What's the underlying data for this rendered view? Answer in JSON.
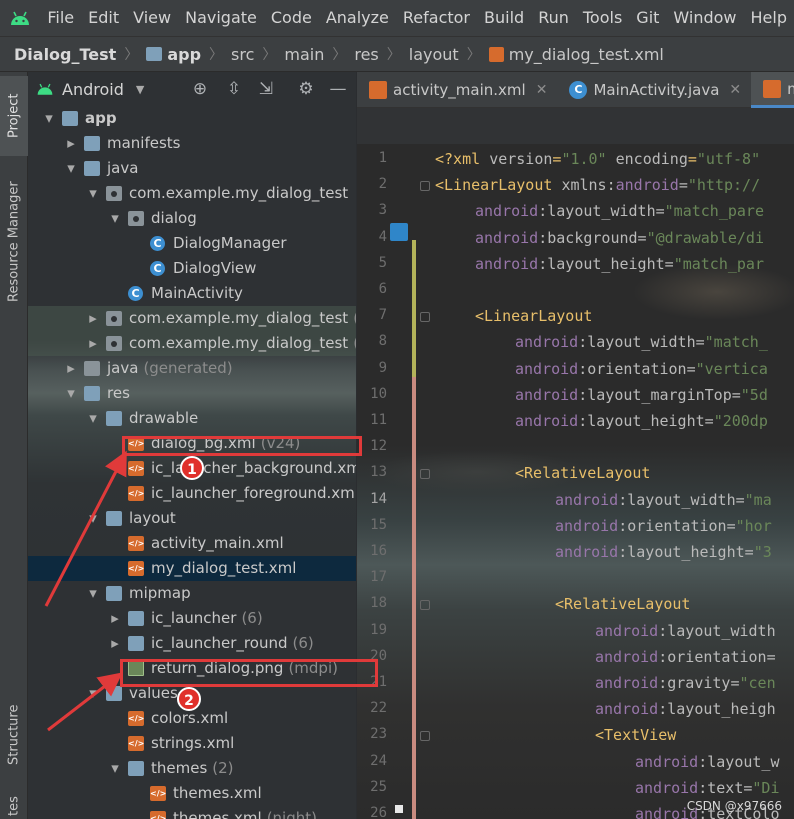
{
  "menubar": {
    "items": [
      "File",
      "Edit",
      "View",
      "Navigate",
      "Code",
      "Analyze",
      "Refactor",
      "Build",
      "Run",
      "Tools",
      "Git",
      "Window",
      "Help"
    ]
  },
  "breadcrumb": [
    "Dialog_Test",
    "app",
    "src",
    "main",
    "res",
    "layout",
    "my_dialog_test.xml"
  ],
  "toolstrip": {
    "project": "Project",
    "resource_manager": "Resource Manager",
    "structure": "Structure",
    "bottom": "tes"
  },
  "project_panel": {
    "view_mode": "Android",
    "tree": [
      {
        "label": "app",
        "depth": 0,
        "expanded": true,
        "icon": "module-icon",
        "bold": true
      },
      {
        "label": "manifests",
        "depth": 1,
        "expanded": false,
        "icon": "folder-icon"
      },
      {
        "label": "java",
        "depth": 1,
        "expanded": true,
        "icon": "folder-icon"
      },
      {
        "label": "com.example.my_dialog_test",
        "depth": 2,
        "expanded": true,
        "icon": "package-icon"
      },
      {
        "label": "dialog",
        "depth": 3,
        "expanded": true,
        "icon": "package-icon"
      },
      {
        "label": "DialogManager",
        "depth": 4,
        "icon": "class-icon"
      },
      {
        "label": "DialogView",
        "depth": 4,
        "icon": "class-icon"
      },
      {
        "label": "MainActivity",
        "depth": 3,
        "icon": "class-icon"
      },
      {
        "label": "com.example.my_dialog_test",
        "sub": "(a",
        "depth": 2,
        "expanded": false,
        "icon": "package-icon",
        "highlight": true
      },
      {
        "label": "com.example.my_dialog_test",
        "sub": "(t",
        "depth": 2,
        "expanded": false,
        "icon": "package-icon",
        "highlight": true
      },
      {
        "label": "java",
        "sub": "(generated)",
        "depth": 1,
        "expanded": false,
        "icon": "generated-folder-icon"
      },
      {
        "label": "res",
        "depth": 1,
        "expanded": true,
        "icon": "folder-icon"
      },
      {
        "label": "drawable",
        "depth": 2,
        "expanded": true,
        "icon": "folder-icon"
      },
      {
        "label": "dialog_bg.xml",
        "sub": "(v24)",
        "depth": 3,
        "icon": "xml-icon"
      },
      {
        "label": "ic_launcher_background.xml",
        "depth": 3,
        "icon": "xml-icon"
      },
      {
        "label": "ic_launcher_foreground.xml",
        "depth": 3,
        "icon": "xml-icon"
      },
      {
        "label": "layout",
        "depth": 2,
        "expanded": true,
        "icon": "folder-icon"
      },
      {
        "label": "activity_main.xml",
        "depth": 3,
        "icon": "xml-icon"
      },
      {
        "label": "my_dialog_test.xml",
        "depth": 3,
        "icon": "xml-icon",
        "selected": true
      },
      {
        "label": "mipmap",
        "depth": 2,
        "expanded": true,
        "icon": "folder-icon"
      },
      {
        "label": "ic_launcher",
        "sub": "(6)",
        "depth": 3,
        "expanded": false,
        "icon": "folder-icon"
      },
      {
        "label": "ic_launcher_round",
        "sub": "(6)",
        "depth": 3,
        "expanded": false,
        "icon": "folder-icon"
      },
      {
        "label": "return_dialog.png",
        "sub": "(mdpi)",
        "depth": 3,
        "icon": "png-icon"
      },
      {
        "label": "values",
        "depth": 2,
        "expanded": true,
        "icon": "folder-icon"
      },
      {
        "label": "colors.xml",
        "depth": 3,
        "icon": "xml-icon"
      },
      {
        "label": "strings.xml",
        "depth": 3,
        "icon": "xml-icon"
      },
      {
        "label": "themes",
        "sub": "(2)",
        "depth": 3,
        "expanded": true,
        "icon": "folder-icon"
      },
      {
        "label": "themes.xml",
        "depth": 4,
        "icon": "xml-icon"
      },
      {
        "label": "themes.xml",
        "sub": "(night)",
        "depth": 4,
        "icon": "xml-icon"
      }
    ]
  },
  "editor": {
    "tabs": [
      {
        "label": "activity_main.xml",
        "icon": "xml-icon",
        "active": false
      },
      {
        "label": "MainActivity.java",
        "icon": "class-icon",
        "active": false
      },
      {
        "label": "my_",
        "icon": "xml-icon",
        "active": true
      }
    ],
    "current_line": 14,
    "lines": [
      {
        "n": 1,
        "indent": 0,
        "parts": [
          [
            "pi",
            "<?xml "
          ],
          [
            "attr",
            "version"
          ],
          [
            "pi",
            "="
          ],
          [
            "val",
            "\"1.0\""
          ],
          [
            "attr",
            " encoding"
          ],
          [
            "pi",
            "="
          ],
          [
            "val",
            "\"utf-8\""
          ]
        ]
      },
      {
        "n": 2,
        "indent": 0,
        "parts": [
          [
            "tag",
            "<LinearLayout "
          ],
          [
            "attr",
            "xmlns:"
          ],
          [
            "ns",
            "android"
          ],
          [
            "attr",
            "="
          ],
          [
            "val",
            "\"http://"
          ]
        ]
      },
      {
        "n": 3,
        "indent": 4,
        "parts": [
          [
            "ns",
            "android"
          ],
          [
            "attr",
            ":layout_width="
          ],
          [
            "val",
            "\"match_pare"
          ]
        ]
      },
      {
        "n": 4,
        "indent": 4,
        "parts": [
          [
            "ns",
            "android"
          ],
          [
            "attr",
            ":background="
          ],
          [
            "val",
            "\"@drawable/di"
          ]
        ]
      },
      {
        "n": 5,
        "indent": 4,
        "parts": [
          [
            "ns",
            "android"
          ],
          [
            "attr",
            ":layout_height="
          ],
          [
            "val",
            "\"match_par"
          ]
        ]
      },
      {
        "n": 6,
        "indent": 0,
        "parts": []
      },
      {
        "n": 7,
        "indent": 4,
        "parts": [
          [
            "tag",
            "<LinearLayout"
          ]
        ]
      },
      {
        "n": 8,
        "indent": 8,
        "parts": [
          [
            "ns",
            "android"
          ],
          [
            "attr",
            ":layout_width="
          ],
          [
            "val",
            "\"match_"
          ]
        ]
      },
      {
        "n": 9,
        "indent": 8,
        "parts": [
          [
            "ns",
            "android"
          ],
          [
            "attr",
            ":orientation="
          ],
          [
            "val",
            "\"vertica"
          ]
        ]
      },
      {
        "n": 10,
        "indent": 8,
        "parts": [
          [
            "ns",
            "android"
          ],
          [
            "attr",
            ":layout_marginTop="
          ],
          [
            "val",
            "\"5d"
          ]
        ]
      },
      {
        "n": 11,
        "indent": 8,
        "parts": [
          [
            "ns",
            "android"
          ],
          [
            "attr",
            ":layout_height="
          ],
          [
            "val",
            "\"200dp"
          ]
        ]
      },
      {
        "n": 12,
        "indent": 0,
        "parts": []
      },
      {
        "n": 13,
        "indent": 8,
        "parts": [
          [
            "tag",
            "<RelativeLayout"
          ]
        ]
      },
      {
        "n": 14,
        "indent": 12,
        "parts": [
          [
            "ns",
            "android"
          ],
          [
            "attr",
            ":layout_width="
          ],
          [
            "val",
            "\"ma"
          ]
        ]
      },
      {
        "n": 15,
        "indent": 12,
        "parts": [
          [
            "ns",
            "android"
          ],
          [
            "attr",
            ":orientation="
          ],
          [
            "val",
            "\"hor"
          ]
        ]
      },
      {
        "n": 16,
        "indent": 12,
        "parts": [
          [
            "ns",
            "android"
          ],
          [
            "attr",
            ":layout_height="
          ],
          [
            "val",
            "\"3"
          ]
        ]
      },
      {
        "n": 17,
        "indent": 0,
        "parts": []
      },
      {
        "n": 18,
        "indent": 12,
        "parts": [
          [
            "tag",
            "<RelativeLayout"
          ]
        ]
      },
      {
        "n": 19,
        "indent": 16,
        "parts": [
          [
            "ns",
            "android"
          ],
          [
            "attr",
            ":layout_width"
          ]
        ]
      },
      {
        "n": 20,
        "indent": 16,
        "parts": [
          [
            "ns",
            "android"
          ],
          [
            "attr",
            ":orientation="
          ]
        ]
      },
      {
        "n": 21,
        "indent": 16,
        "parts": [
          [
            "ns",
            "android"
          ],
          [
            "attr",
            ":gravity="
          ],
          [
            "val",
            "\"cen"
          ]
        ]
      },
      {
        "n": 22,
        "indent": 16,
        "parts": [
          [
            "ns",
            "android"
          ],
          [
            "attr",
            ":layout_heigh"
          ]
        ]
      },
      {
        "n": 23,
        "indent": 16,
        "parts": [
          [
            "tag",
            "<TextView"
          ]
        ]
      },
      {
        "n": 24,
        "indent": 20,
        "parts": [
          [
            "ns",
            "android"
          ],
          [
            "attr",
            ":layout_w"
          ]
        ]
      },
      {
        "n": 25,
        "indent": 20,
        "parts": [
          [
            "ns",
            "android"
          ],
          [
            "attr",
            ":text="
          ],
          [
            "val",
            "\"Di"
          ]
        ]
      },
      {
        "n": 26,
        "indent": 20,
        "parts": [
          [
            "ns",
            "android"
          ],
          [
            "attr",
            ":textColo"
          ]
        ]
      }
    ]
  },
  "annotations": {
    "badge_1": "1",
    "badge_2": "2",
    "watermark": "CSDN @x97666"
  },
  "colors": {
    "accent": "#4a88c7",
    "annotation_red": "#e03a3a",
    "selection": "#0d293e"
  }
}
